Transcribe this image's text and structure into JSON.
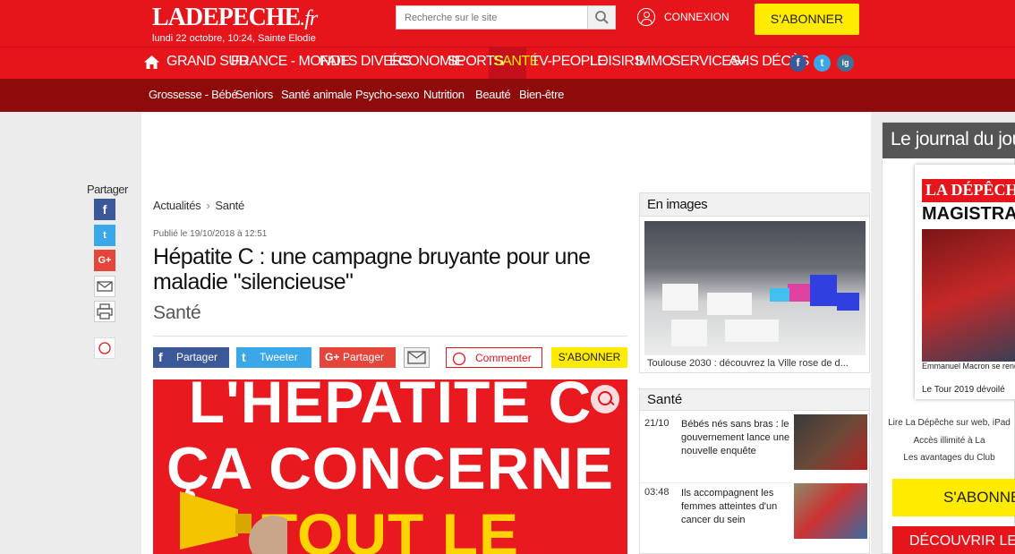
{
  "header": {
    "logo": "LADEPECHE",
    "logo_ext": ".fr",
    "date": "lundi 22 octobre, 10:24, Sainte Elodie",
    "search_placeholder": "Recherche sur le site",
    "login": "CONNEXION",
    "subscribe": "S'ABONNER"
  },
  "nav": {
    "items": [
      "GRAND SUD",
      "FRANCE - MONDE",
      "FAITS DIVERS",
      "ÉCONOMIE",
      "SPORTS",
      "SANTÉ",
      "TV-PEOPLE",
      "LOISIRS",
      "IMMO",
      "SERVICES+",
      "AVIS DÉCÈS"
    ],
    "active": "SANTÉ",
    "social": [
      "f",
      "t",
      "ig"
    ]
  },
  "subnav": {
    "items": [
      "Grossesse - Bébé",
      "Seniors",
      "Santé animale",
      "Psycho-sexo",
      "Nutrition",
      "Beauté",
      "Bien-être"
    ]
  },
  "share_side": {
    "label": "Partager",
    "icons": [
      "facebook-icon",
      "twitter-icon",
      "googleplus-icon",
      "mail-icon",
      "print-icon",
      "comment-icon"
    ]
  },
  "article": {
    "breadcrumb": [
      "Actualités",
      "Santé"
    ],
    "published": "Publié le 19/10/2018 à 12:51",
    "title": "Hépatite C : une campagne bruyante pour une maladie \"silencieuse\"",
    "section": "Santé",
    "buttons": {
      "facebook": "Partager",
      "twitter": "Tweeter",
      "googleplus": "Partager",
      "comment": "Commenter",
      "subscribe": "S'ABONNER"
    },
    "hero_lines": [
      "L'HÉPATITE C",
      "ÇA CONCERNE",
      "TOUT LE"
    ]
  },
  "en_images": {
    "title": "En images",
    "caption": "Toulouse 2030 : découvrez la Ville rose de d..."
  },
  "sante_box": {
    "title": "Santé",
    "articles": [
      {
        "time": "21/10",
        "text": "Bébés nés sans bras : le gouvernement lance une nouvelle enquête"
      },
      {
        "time": "03:48",
        "text": "Ils accompagnent les femmes atteintes d'un cancer du sein"
      }
    ]
  },
  "journal": {
    "title": "Le journal du jour",
    "cover_logo": "LA DÉPÊCHE",
    "cover_headline": "MAGISTRAL",
    "cover_text1": "Emmanuel Macron se rend cet l'Aude sinistrée ce lundi",
    "cover_text2": "Le Tour 2019 dévoilé",
    "lines": [
      "Lire La Dépêche sur web, iPad",
      "Accès illimité à La",
      "Les avantages du Club"
    ],
    "subscribe": "S'ABONNER",
    "club": "DÉCOUVRIR LE CLUB"
  },
  "colors": {
    "brand_red": "#e6141b",
    "dark_red": "#8f0b0b",
    "accent_yellow": "#ffeb00"
  }
}
